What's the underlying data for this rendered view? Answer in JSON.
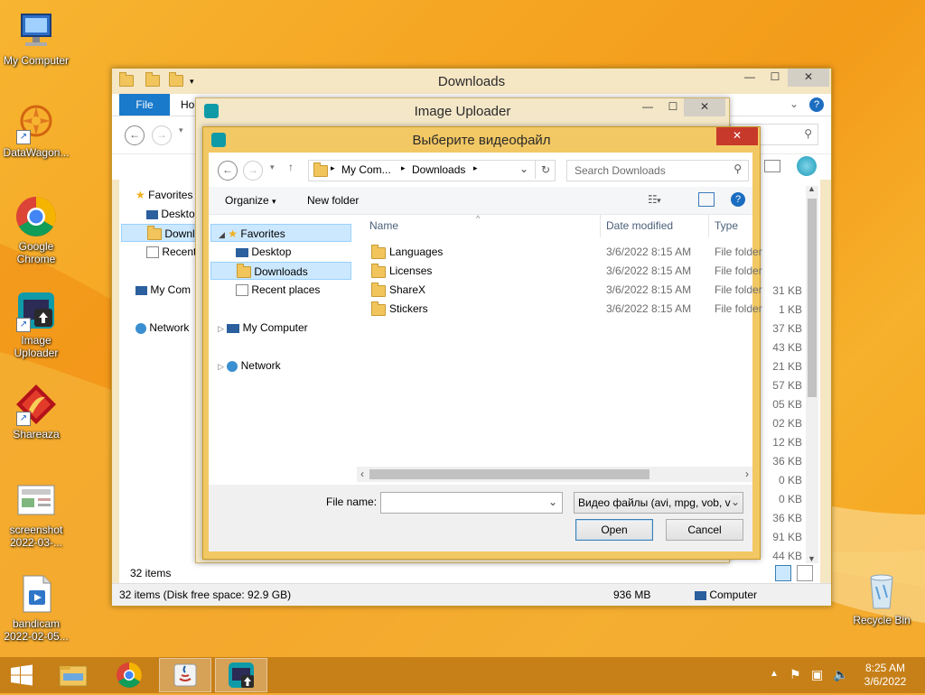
{
  "desktop": {
    "icons": [
      {
        "label": "My Computer"
      },
      {
        "label": "DataWagon..."
      },
      {
        "label": "Google Chrome"
      },
      {
        "label": "Image Uploader"
      },
      {
        "label": "Shareaza"
      },
      {
        "label": "screenshot 2022-03-..."
      },
      {
        "label": "bandicam 2022-02-05..."
      },
      {
        "label": "Recycle Bin"
      }
    ]
  },
  "explorer": {
    "title": "Downloads",
    "ribbon_tabs": [
      "File",
      "Ho"
    ],
    "nav": [
      "Favorites",
      "Deskto",
      "Downl",
      "Recent",
      "My Com",
      "Network"
    ],
    "sizes": [
      "31 KB",
      "1 KB",
      "37 KB",
      "43 KB",
      "21 KB",
      "57 KB",
      "05 KB",
      "02 KB",
      "12 KB",
      "36 KB",
      "0 KB",
      "0 KB",
      "36 KB",
      "91 KB",
      "44 KB"
    ],
    "item_count": "32 items",
    "status_left": "32 items (Disk free space: 92.9 GB)",
    "status_mid": "936 MB",
    "status_right": "Computer"
  },
  "uploader": {
    "title": "Image Uploader"
  },
  "dialog": {
    "title": "Выберите видеофайл",
    "breadcrumb": [
      "My Com...",
      "Downloads"
    ],
    "search_placeholder": "Search Downloads",
    "organize": "Organize",
    "new_folder": "New folder",
    "nav": {
      "favorites": "Favorites",
      "desktop": "Desktop",
      "downloads": "Downloads",
      "recent": "Recent places",
      "computer": "My Computer",
      "network": "Network"
    },
    "columns": {
      "name": "Name",
      "date": "Date modified",
      "type": "Type"
    },
    "files": [
      {
        "name": "Languages",
        "date": "3/6/2022 8:15 AM",
        "type": "File folder"
      },
      {
        "name": "Licenses",
        "date": "3/6/2022 8:15 AM",
        "type": "File folder"
      },
      {
        "name": "ShareX",
        "date": "3/6/2022 8:15 AM",
        "type": "File folder"
      },
      {
        "name": "Stickers",
        "date": "3/6/2022 8:15 AM",
        "type": "File folder"
      }
    ],
    "filename_label": "File name:",
    "filename_value": "",
    "filetype": "Видео файлы (avi, mpg, vob, v",
    "open": "Open",
    "cancel": "Cancel"
  },
  "taskbar": {
    "time": "8:25 AM",
    "date": "3/6/2022"
  },
  "colors": {
    "accent": "#f5a623",
    "close_red": "#c7392b",
    "selection": "#cce8ff"
  }
}
